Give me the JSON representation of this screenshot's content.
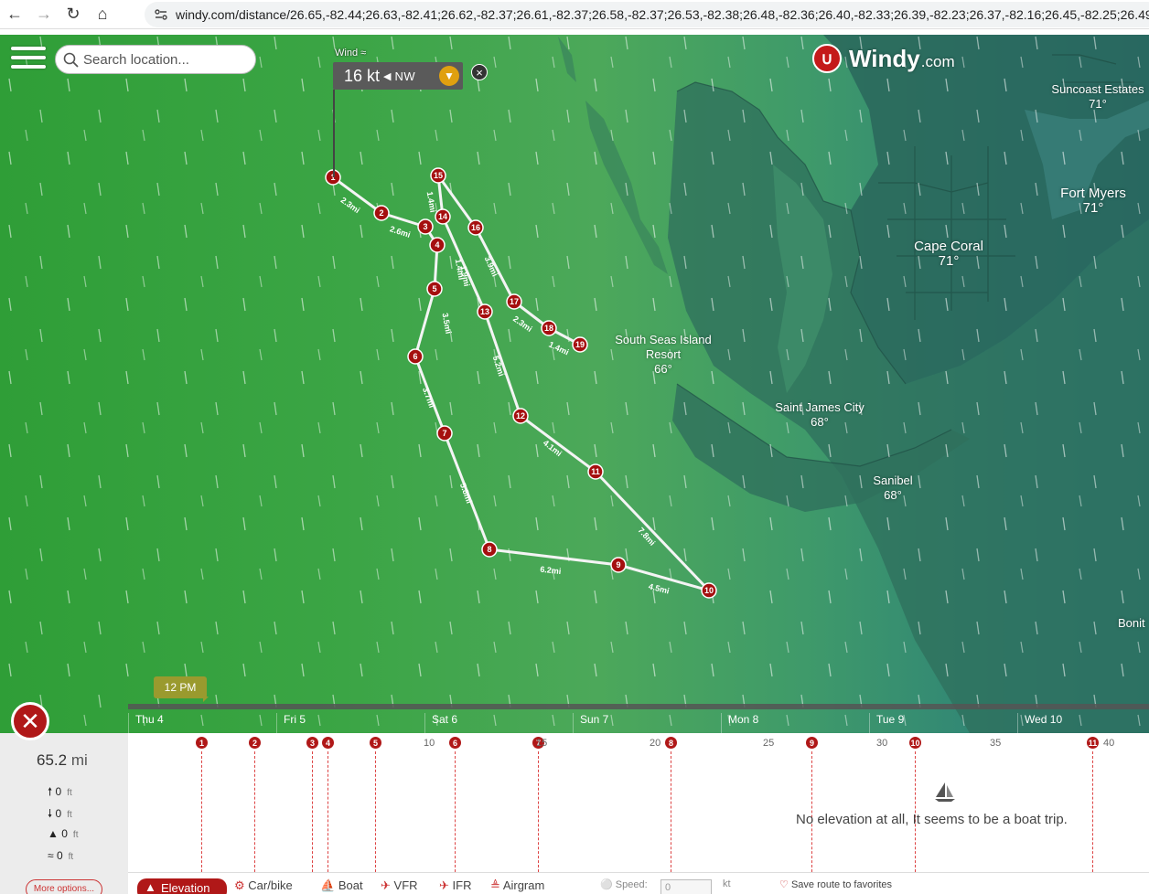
{
  "browser": {
    "url": "windy.com/distance/26.65,-82.44;26.63,-82.41;26.62,-82.37;26.61,-82.37;26.58,-82.37;26.53,-82.38;26.48,-82.36;26.40,-82.33;26.39,-82.23;26.37,-82.16;26.45,-82.25;26.49,-82.30"
  },
  "search": {
    "placeholder": "Search location..."
  },
  "wind": {
    "title": "Wind",
    "speed": "16 kt",
    "direction": "NW"
  },
  "logo": {
    "name": "Windy",
    "suffix": ".com"
  },
  "cities": [
    {
      "name": "Suncoast Estates",
      "temp": "71°"
    },
    {
      "name": "Fort Myers",
      "temp": "71°"
    },
    {
      "name": "Cape Coral",
      "temp": "71°"
    },
    {
      "name": "South Seas Island",
      "name2": "Resort",
      "temp": "66°"
    },
    {
      "name": "Saint James City",
      "temp": "68°"
    },
    {
      "name": "Sanibel",
      "temp": "68°"
    },
    {
      "name": "Bonit",
      "temp": ""
    }
  ],
  "route": {
    "waypoints": [
      "1",
      "2",
      "3",
      "4",
      "5",
      "6",
      "7",
      "8",
      "9",
      "10",
      "11",
      "12",
      "13",
      "14",
      "15",
      "16",
      "17",
      "18",
      "19"
    ],
    "segment_labels": [
      "2.3mi",
      "2.6mi",
      "1.4mi",
      "1.4mi",
      "3.5mi",
      "3.7mi",
      "5.8mi",
      "6.2mi",
      "4.5mi",
      "7.8mi",
      "4.1mi",
      "5.2mi",
      "3.9mi",
      "2.3mi",
      "1.4mi",
      "1.9mi"
    ]
  },
  "timeline": {
    "current_time": "12 PM",
    "days": [
      "Thu 4",
      "Fri 5",
      "Sat 6",
      "Sun 7",
      "Mon 8",
      "Tue 9",
      "Wed 10"
    ]
  },
  "summary": {
    "total_distance": "65.2",
    "distance_unit": "mi",
    "ascent": "0",
    "descent": "0",
    "max": "0",
    "avg": "0",
    "unit": "ft",
    "more_options": "More options..."
  },
  "elevation": {
    "markers": [
      "1",
      "2",
      "3",
      "4",
      "5",
      "6",
      "7",
      "8",
      "9",
      "10",
      "11"
    ],
    "ticks": [
      "10",
      "15",
      "20",
      "25",
      "30",
      "35",
      "40"
    ],
    "message": "No elevation at all, It seems to be a boat trip."
  },
  "modes": {
    "elevation": "Elevation",
    "car": "Car/bike",
    "boat": "Boat",
    "vfr": "VFR",
    "ifr": "IFR",
    "airgram": "Airgram",
    "speed_label": "Speed:",
    "speed_value": "0",
    "speed_unit": "kt",
    "save": "Save route to favorites"
  }
}
